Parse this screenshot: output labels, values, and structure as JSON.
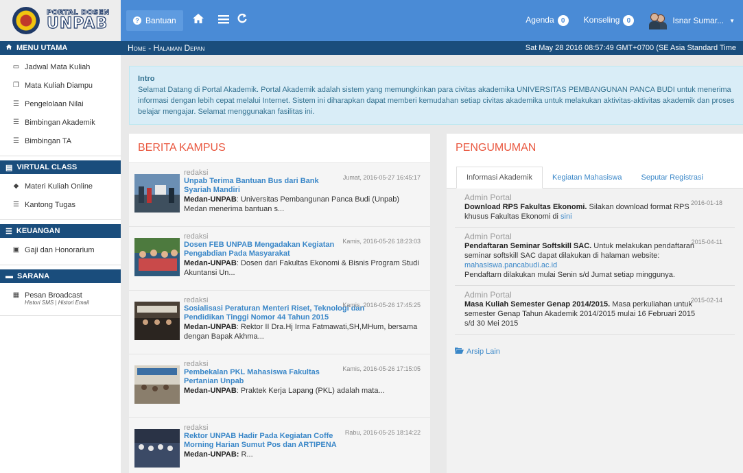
{
  "header": {
    "logo_small": "PORTAL DOSEN",
    "logo_big": "UNPAB",
    "help_label": "Bantuan",
    "agenda_label": "Agenda",
    "agenda_count": "0",
    "konseling_label": "Konseling",
    "konseling_count": "0",
    "user_name": "Isnar Sumar...",
    "colors": {
      "primary": "#4a8bd6",
      "dark": "#1a4d7c"
    }
  },
  "breadcrumb": {
    "text": "Home - Halaman Depan",
    "datetime": "Sat May 28 2016 08:57:49 GMT+0700 (SE Asia Standard Time"
  },
  "sidebar": {
    "sections": [
      {
        "title": "MENU UTAMA",
        "icon": "home-icon",
        "items": [
          {
            "label": "Jadwal Mata Kuliah",
            "icon": "card-icon"
          },
          {
            "label": "Mata Kuliah Diampu",
            "icon": "copy-icon"
          },
          {
            "label": "Pengelolaan Nilai",
            "icon": "list-icon"
          },
          {
            "label": "Bimbingan Akademik",
            "icon": "list-icon"
          },
          {
            "label": "Bimbingan TA",
            "icon": "list-icon"
          }
        ]
      },
      {
        "title": "VIRTUAL CLASS",
        "icon": "book-icon",
        "items": [
          {
            "label": "Materi Kuliah Online",
            "icon": "tag-icon"
          },
          {
            "label": "Kantong Tugas",
            "icon": "list-icon"
          }
        ]
      },
      {
        "title": "KEUANGAN",
        "icon": "list-icon",
        "items": [
          {
            "label": "Gaji dan Honorarium",
            "icon": "money-icon"
          }
        ]
      },
      {
        "title": "SARANA",
        "icon": "hdd-icon",
        "items": [
          {
            "label": "Pesan Broadcast",
            "icon": "grid-icon",
            "sub": "Histori SMS | Histori Email"
          }
        ]
      }
    ]
  },
  "intro": {
    "title": "Intro",
    "text": "Selamat Datang di Portal Akademik. Portal Akademik adalah sistem yang memungkinkan para civitas akademika UNIVERSITAS PEMBANGUNAN PANCA BUDI untuk menerima informasi dengan lebih cepat melalui Internet. Sistem ini diharapkan dapat memberi kemudahan setiap civitas akademika untuk melakukan aktivitas-aktivitas akademik dan proses belajar mengajar. Selamat menggunakan fasilitas ini."
  },
  "berita": {
    "title": "BERITA KAMPUS",
    "items": [
      {
        "author": "redaksi",
        "date": "Jumat, 2016-05-27 16:45:17",
        "title": "Unpab Terima Bantuan Bus dari Bank Syariah Mandiri",
        "lead": "Medan-UNPAB",
        "body": ": Universitas Pembangunan Panca Budi (Unpab) Medan menerima bantuan s..."
      },
      {
        "author": "redaksi",
        "date": "Kamis, 2016-05-26 18:23:03",
        "title": "Dosen FEB UNPAB Mengadakan Kegiatan Pengabdian Pada Masyarakat",
        "lead": "Medan-UNPAB",
        "body": ": Dosen dari Fakultas Ekonomi & Bisnis Program Studi Akuntansi Un..."
      },
      {
        "author": "redaksi",
        "date": "Kamis, 2016-05-26 17:45:25",
        "title": "Sosialisasi Peraturan Menteri Riset, Teknologi dan Pendidikan Tinggi Nomor 44 Tahun 2015",
        "lead": "Medan-UNPAB",
        "body": ": Rektor II Dra.Hj Irma Fatmawati,SH,MHum, bersama dengan Bapak Akhma..."
      },
      {
        "author": "redaksi",
        "date": "Kamis, 2016-05-26 17:15:05",
        "title": "Pembekalan PKL Mahasiswa Fakultas Pertanian Unpab",
        "lead": "Medan-UNPAB",
        "body": ": Praktek Kerja Lapang (PKL) adalah mata..."
      },
      {
        "author": "redaksi",
        "date": "Rabu, 2016-05-25 18:14:22",
        "title": "Rektor UNPAB Hadir Pada Kegiatan Coffe Morning Harian Sumut Pos dan ARTIPENA",
        "lead": "Medan-UNPAB:",
        "body": " R..."
      }
    ]
  },
  "pengumuman": {
    "title": "PENGUMUMAN",
    "tabs": [
      "Informasi Akademik",
      "Kegiatan Mahasiswa",
      "Seputar Registrasi"
    ],
    "items": [
      {
        "author": "Admin Portal",
        "date": "2016-01-18",
        "lead": "Download RPS Fakultas Ekonomi.",
        "body": " Silakan download format RPS khusus Fakultas Ekonomi di ",
        "link": "sini",
        "extra": ""
      },
      {
        "author": "Admin Portal",
        "date": "2015-04-11",
        "lead": "Pendaftaran Seminar Softskill SAC.",
        "body": " Untuk melakukan pendaftaran seminar softskill SAC dapat dilakukan di halaman website: ",
        "link": "mahasiswa.pancabudi.ac.id",
        "extra": "Pendaftarn dilakukan mulai Senin s/d Jumat setiap minggunya."
      },
      {
        "author": "Admin Portal",
        "date": "2015-02-14",
        "lead": "Masa Kuliah Semester Genap 2014/2015.",
        "body": " Masa perkuliahan untuk semester Genap Tahun Akademik 2014/2015 mulai 16 Februari 2015 s/d 30 Mei 2015",
        "link": "",
        "extra": ""
      }
    ],
    "archive_label": "Arsip Lain"
  }
}
